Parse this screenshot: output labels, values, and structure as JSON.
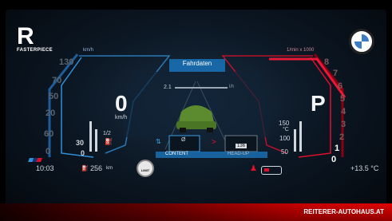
{
  "brand": {
    "logo_letter": "R",
    "logo_text": "FASTERPIECE",
    "right_logo": "bmw-roundel-icon"
  },
  "left_gauge": {
    "unit_top": "km/h",
    "speed_value": "0",
    "speed_unit": "km/h",
    "scale": [
      "130",
      "70",
      "50",
      "20",
      "60",
      "0"
    ]
  },
  "right_gauge": {
    "unit_top": "1/min x 1000",
    "gear": "P",
    "scale": [
      "8",
      "7",
      "6",
      "5",
      "4",
      "3",
      "2",
      "1",
      "0"
    ]
  },
  "left_stack": {
    "fuel_label": "1/2",
    "lower": "30",
    "bottom": "0"
  },
  "right_stack": {
    "temp_value": "150",
    "temp_unit": "°C",
    "mid": "100",
    "low": "50"
  },
  "center": {
    "title": "Fahrdaten",
    "bar_left_value": "2.1",
    "bar_right_unit": "l/h",
    "tab_left": "CONTENT",
    "tab_right": "HEAD-UP",
    "tile_left_label": "Ø",
    "tile_right_value": "136",
    "arrow_label": ">"
  },
  "status": {
    "time": "10:03",
    "range": "256",
    "range_unit": "km",
    "limit": "LIMIT",
    "temperature": "+13.5 °C"
  },
  "dealer": "REITERER-AUTOHAUS.AT",
  "colors": {
    "left_accent": "#2f8fd9",
    "right_accent": "#e0102a",
    "center_title": "#3aa0e8"
  }
}
